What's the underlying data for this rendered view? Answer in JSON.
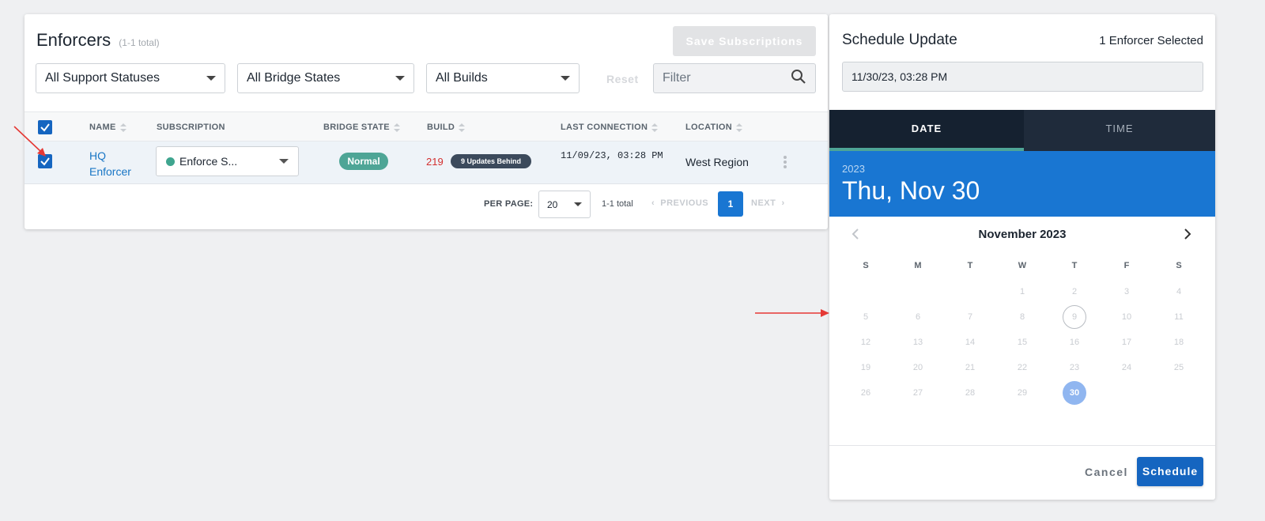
{
  "enforcers": {
    "title": "Enforcers",
    "count": "(1-1 total)",
    "save_label": "Save Subscriptions",
    "filters": {
      "support": "All Support Statuses",
      "bridge": "All Bridge States",
      "builds": "All Builds",
      "reset": "Reset",
      "filter_placeholder": "Filter"
    },
    "columns": {
      "name": "NAME",
      "subscription": "SUBSCRIPTION",
      "bridge_state": "BRIDGE STATE",
      "build": "BUILD",
      "last_connection": "LAST CONNECTION",
      "location": "LOCATION"
    },
    "row": {
      "name": "HQ Enforcer",
      "subscription": "Enforce S...",
      "bridge_state": "Normal",
      "build": "219",
      "updates_behind": "9 Updates Behind",
      "last_connection": "11/09/23, 03:28 PM",
      "location": "West Region"
    },
    "pager": {
      "per_page_label": "PER PAGE:",
      "per_page": "20",
      "total": "1-1 total",
      "previous": "PREVIOUS",
      "page": "1",
      "next": "NEXT"
    }
  },
  "schedule": {
    "title": "Schedule Update",
    "selected": "1 Enforcer Selected",
    "datetime_value": "11/30/23, 03:28 PM",
    "tab_date": "DATE",
    "tab_time": "TIME",
    "header_year": "2023",
    "header_date": "Thu, Nov 30",
    "month": "November 2023",
    "weekdays": [
      "S",
      "M",
      "T",
      "W",
      "T",
      "F",
      "S"
    ],
    "first_weekday": 3,
    "days_in_month": 30,
    "today": 9,
    "selected_day": 30,
    "cancel": "Cancel",
    "schedule": "Schedule"
  }
}
